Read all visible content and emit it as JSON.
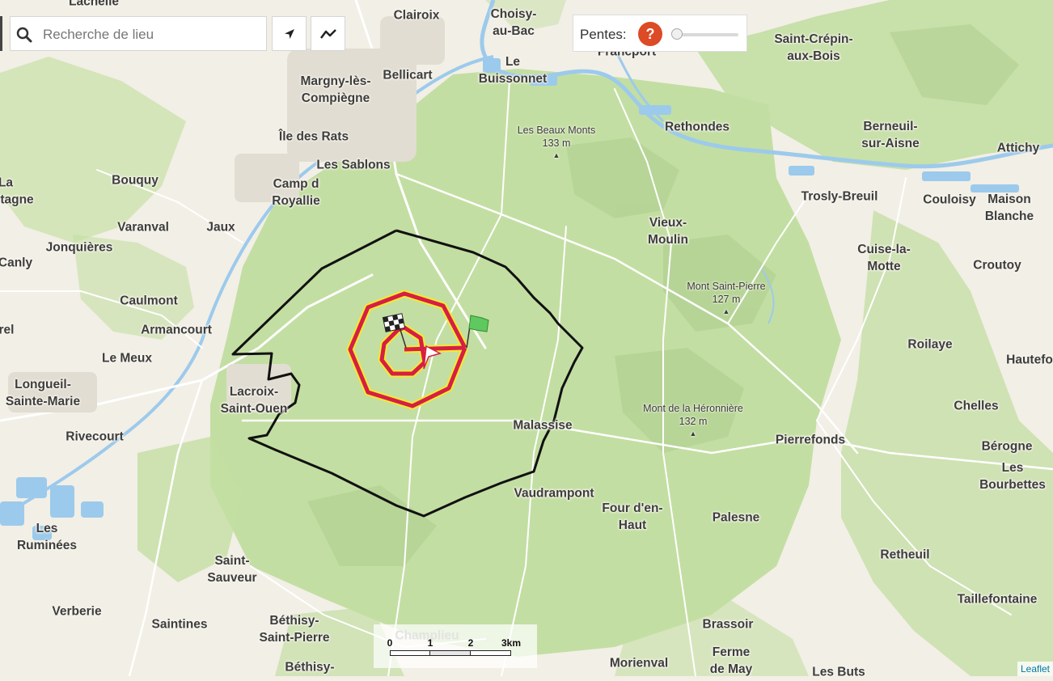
{
  "search": {
    "placeholder": "Recherche de lieu"
  },
  "toolbar": {
    "locate_icon": "locate-arrow-icon",
    "route_icon": "route-profile-icon"
  },
  "slope_control": {
    "label": "Pentes:",
    "help_label": "?",
    "value": 0
  },
  "scale": {
    "labels": [
      "0",
      "1",
      "2",
      "3km"
    ]
  },
  "attribution": "Leaflet",
  "colors": {
    "forest": "#c3dea2",
    "water": "#9ccaec",
    "outer_track": "#111111",
    "inner_spiral": "#d61f45",
    "spiral_halo": "#f3ea2e",
    "start_flag": "#5fc85f"
  },
  "map": {
    "places": [
      {
        "id": "lachelle",
        "name": "Lachelle"
      },
      {
        "id": "clairoix",
        "name": "Clairoix"
      },
      {
        "id": "choisy-au-bac",
        "name": "Choisy-\nau-Bac"
      },
      {
        "id": "francport",
        "name": "Francport"
      },
      {
        "id": "saint-crepin-aux-bois",
        "name": "Saint-Crépin-\naux-Bois"
      },
      {
        "id": "le-buissonnet",
        "name": "Le\nBuissonnet"
      },
      {
        "id": "bellicart",
        "name": "Bellicart"
      },
      {
        "id": "margny-les-compiegne",
        "name": "Margny-lès-\nCompiègne"
      },
      {
        "id": "rethondes",
        "name": "Rethondes"
      },
      {
        "id": "berneuil-sur-aisne",
        "name": "Berneuil-\nsur-Aisne"
      },
      {
        "id": "attichy",
        "name": "Attichy"
      },
      {
        "id": "ile-des-rats",
        "name": "Île des Rats"
      },
      {
        "id": "les-sablons",
        "name": "Les Sablons"
      },
      {
        "id": "bouquy",
        "name": "Bouquy"
      },
      {
        "id": "la",
        "name": "La"
      },
      {
        "id": "tagne",
        "name": "tagne"
      },
      {
        "id": "camp-d-royallie",
        "name": "Camp d\nRoyallie"
      },
      {
        "id": "trosly-breuil",
        "name": "Trosly-Breuil"
      },
      {
        "id": "couloisy",
        "name": "Couloisy"
      },
      {
        "id": "maison-blanche",
        "name": "Maison\nBlanche"
      },
      {
        "id": "varanval",
        "name": "Varanval"
      },
      {
        "id": "jaux",
        "name": "Jaux"
      },
      {
        "id": "vieux-moulin",
        "name": "Vieux-\nMoulin"
      },
      {
        "id": "jonquieres",
        "name": "Jonquières"
      },
      {
        "id": "canly",
        "name": "Canly"
      },
      {
        "id": "cuise-la-motte",
        "name": "Cuise-la-\nMotte"
      },
      {
        "id": "croutoy",
        "name": "Croutoy"
      },
      {
        "id": "caulmont",
        "name": "Caulmont"
      },
      {
        "id": "armancourt",
        "name": "Armancourt"
      },
      {
        "id": "rel",
        "name": "rel"
      },
      {
        "id": "roilaye",
        "name": "Roilaye"
      },
      {
        "id": "le-meux",
        "name": "Le Meux"
      },
      {
        "id": "hautefo",
        "name": "Hautefo"
      },
      {
        "id": "longueil-sainte-marie",
        "name": "Longueil-\nSainte-Marie"
      },
      {
        "id": "lacroix-saint-ouen",
        "name": "Lacroix-\nSaint-Ouen"
      },
      {
        "id": "chelles",
        "name": "Chelles"
      },
      {
        "id": "malassise",
        "name": "Malassise"
      },
      {
        "id": "rivecourt",
        "name": "Rivecourt"
      },
      {
        "id": "pierrefonds",
        "name": "Pierrefonds"
      },
      {
        "id": "berogne",
        "name": "Bérogne"
      },
      {
        "id": "les-bourbettes",
        "name": "Les\nBourbettes"
      },
      {
        "id": "vaudrampont",
        "name": "Vaudrampont"
      },
      {
        "id": "four-d-en-haut",
        "name": "Four d'en-\nHaut"
      },
      {
        "id": "palesne",
        "name": "Palesne"
      },
      {
        "id": "les-ruminees",
        "name": "Les\nRuminées"
      },
      {
        "id": "retheuil",
        "name": "Retheuil"
      },
      {
        "id": "saint-sauveur",
        "name": "Saint-\nSauveur"
      },
      {
        "id": "taillefontaine",
        "name": "Taillefontaine"
      },
      {
        "id": "verberie",
        "name": "Verberie"
      },
      {
        "id": "saintines",
        "name": "Saintines"
      },
      {
        "id": "bethisy-saint-pierre",
        "name": "Béthisy-\nSaint-Pierre"
      },
      {
        "id": "brassoir",
        "name": "Brassoir"
      },
      {
        "id": "champlieu",
        "name": "Champlieu"
      },
      {
        "id": "morienval",
        "name": "Morienval"
      },
      {
        "id": "ferme-de-may",
        "name": "Ferme\nde May"
      },
      {
        "id": "bethisy-2",
        "name": "Béthisy-"
      },
      {
        "id": "les-buts",
        "name": "Les Buts"
      }
    ],
    "peaks": [
      {
        "id": "les-beaux-monts",
        "name": "Les Beaux Monts",
        "elevation": "133 m"
      },
      {
        "id": "mont-saint-pierre",
        "name": "Mont Saint-Pierre",
        "elevation": "127 m"
      },
      {
        "id": "mont-de-la-heronniere",
        "name": "Mont de la Héronnière",
        "elevation": "132 m"
      }
    ]
  }
}
